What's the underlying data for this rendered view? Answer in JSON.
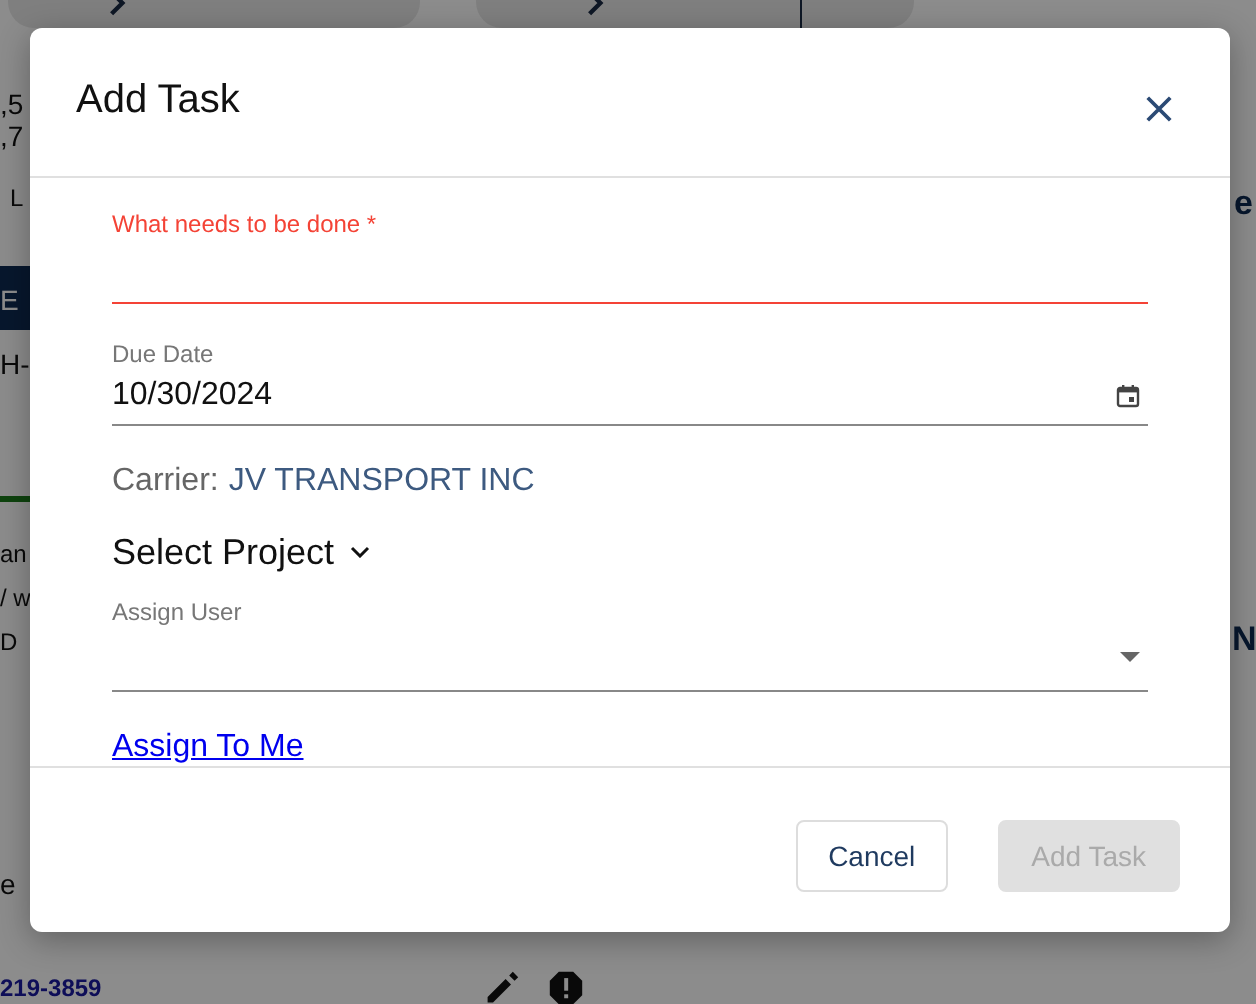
{
  "background": {
    "fragments": [
      {
        "kind": "plain",
        "text": ",5"
      },
      {
        "kind": "plain",
        "text": ",7"
      },
      {
        "kind": "small",
        "text": "L"
      },
      {
        "kind": "bar",
        "text": "E"
      },
      {
        "kind": "plain",
        "text": "H-"
      },
      {
        "kind": "small",
        "text": "an"
      },
      {
        "kind": "small",
        "text": "/ w"
      },
      {
        "kind": "small",
        "text": "D"
      },
      {
        "kind": "plain",
        "text": "e"
      },
      {
        "kind": "phone",
        "text": "219-3859"
      },
      {
        "kind": "heading",
        "text": "e"
      },
      {
        "kind": "heading",
        "text": "N"
      }
    ]
  },
  "dialog": {
    "title": "Add Task",
    "task_field": {
      "label": "What needs to be done *",
      "invalid": true
    },
    "due_date": {
      "label": "Due Date",
      "value": "10/30/2024"
    },
    "carrier": {
      "label": "Carrier:",
      "value": "JV TRANSPORT INC"
    },
    "project": {
      "label": "Select Project",
      "expanded": false
    },
    "assign_user": {
      "label": "Assign User"
    },
    "assign_link": "Assign To Me",
    "buttons": [
      {
        "label": "Cancel",
        "disabled": false
      },
      {
        "label": "Add Task",
        "disabled": true
      }
    ]
  }
}
